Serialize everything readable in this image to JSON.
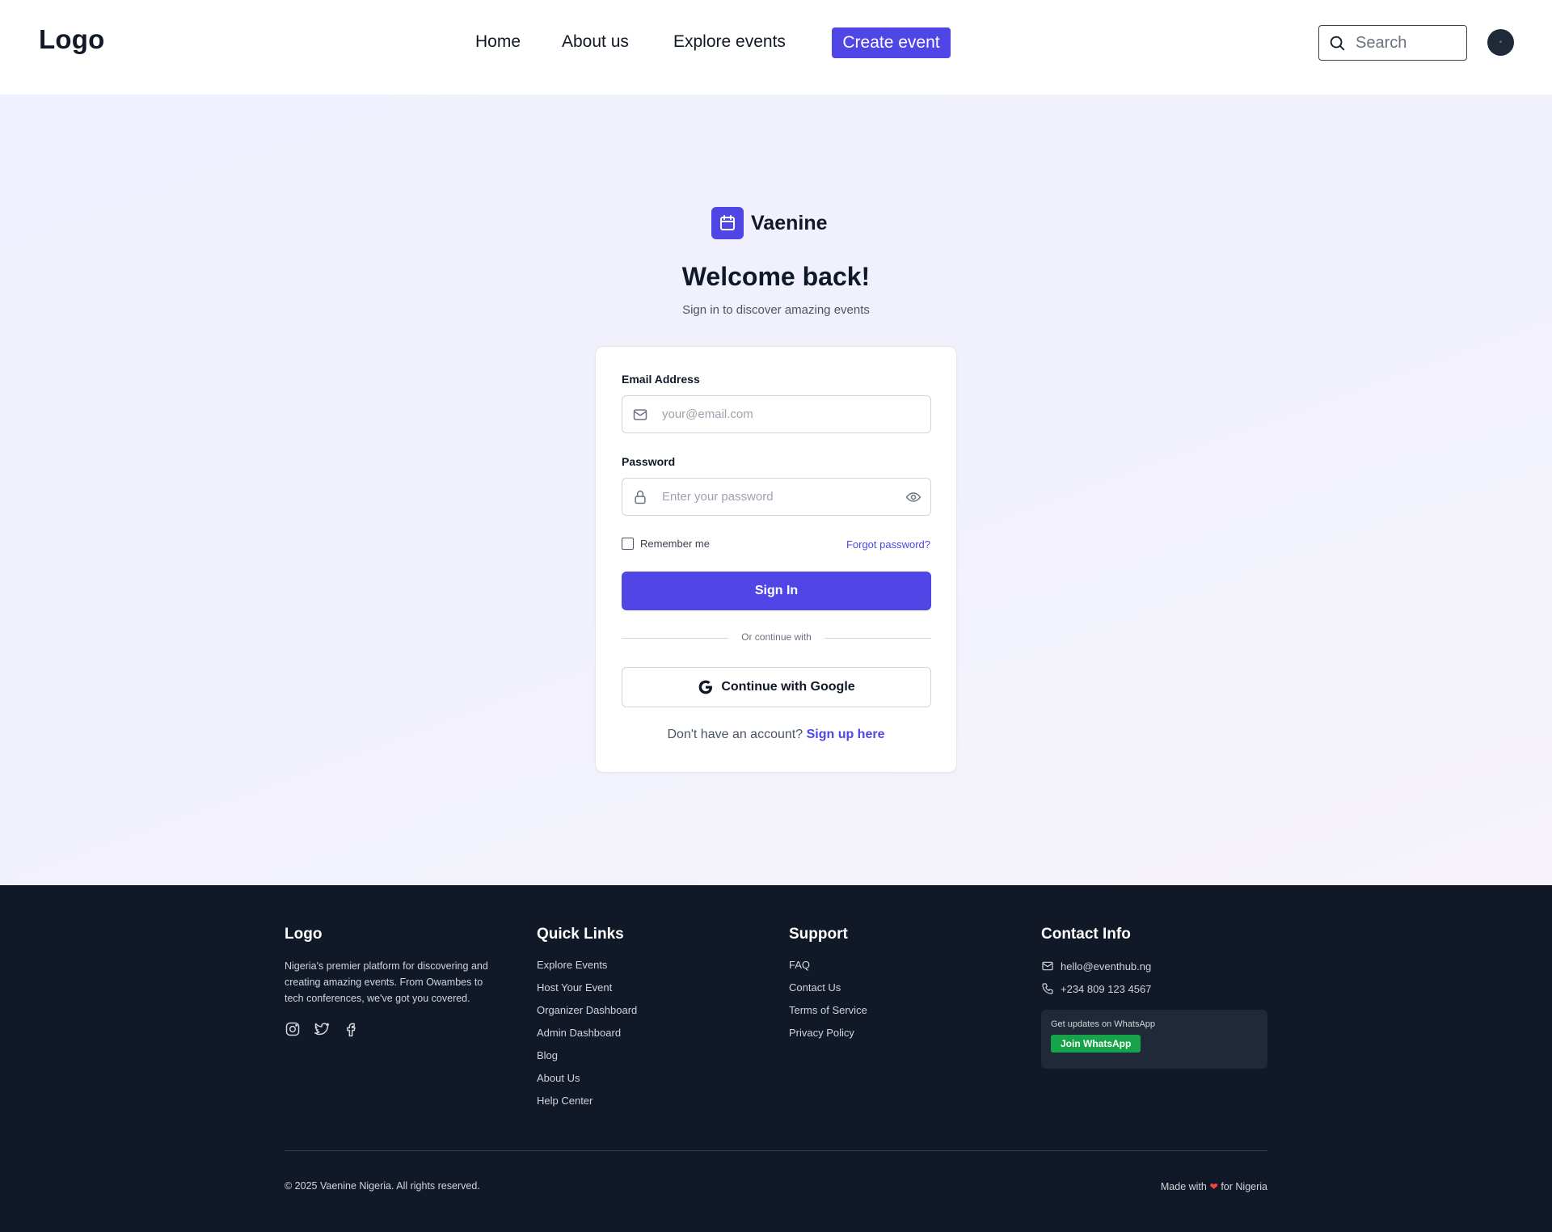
{
  "header": {
    "logo": "Logo",
    "nav": [
      {
        "label": "Home"
      },
      {
        "label": "About us"
      },
      {
        "label": "Explore events"
      }
    ],
    "cta_label": "Create event",
    "search_placeholder": "Search"
  },
  "brand": {
    "name": "Vaenine",
    "accent": "#4f46e5"
  },
  "login": {
    "title": "Welcome back!",
    "subtitle": "Sign in to discover amazing events",
    "email_label": "Email Address",
    "email_placeholder": "your@email.com",
    "password_label": "Password",
    "password_placeholder": "Enter your password",
    "remember_label": "Remember me",
    "forgot_label": "Forgot password?",
    "signin_label": "Sign In",
    "divider_text": "Or continue with",
    "google_label": "Continue with Google",
    "signup_prompt": "Don't have an account?",
    "signup_link": "Sign up here"
  },
  "footer": {
    "logo": "Logo",
    "description": "Nigeria's premier platform for discovering and creating amazing events. From Owambes to tech conferences, we've got you covered.",
    "social_icons": [
      "instagram-icon",
      "twitter-icon",
      "facebook-icon"
    ],
    "quick_links_title": "Quick Links",
    "quick_links": [
      "Explore Events",
      "Host Your Event",
      "Organizer Dashboard",
      "Admin Dashboard",
      "Blog",
      "About Us",
      "Help Center"
    ],
    "support_title": "Support",
    "support_links": [
      "FAQ",
      "Contact Us",
      "Terms of Service",
      "Privacy Policy"
    ],
    "contact_title": "Contact Info",
    "email": "hello@eventhub.ng",
    "phone": "+234 809 123 4567",
    "whatsapp_text": "Get updates on WhatsApp",
    "whatsapp_button": "Join WhatsApp",
    "copyright": "© 2025 Vaenine Nigeria. All rights reserved.",
    "made_with_prefix": "Made with",
    "made_with_suffix": "for Nigeria",
    "background": "#111827"
  }
}
